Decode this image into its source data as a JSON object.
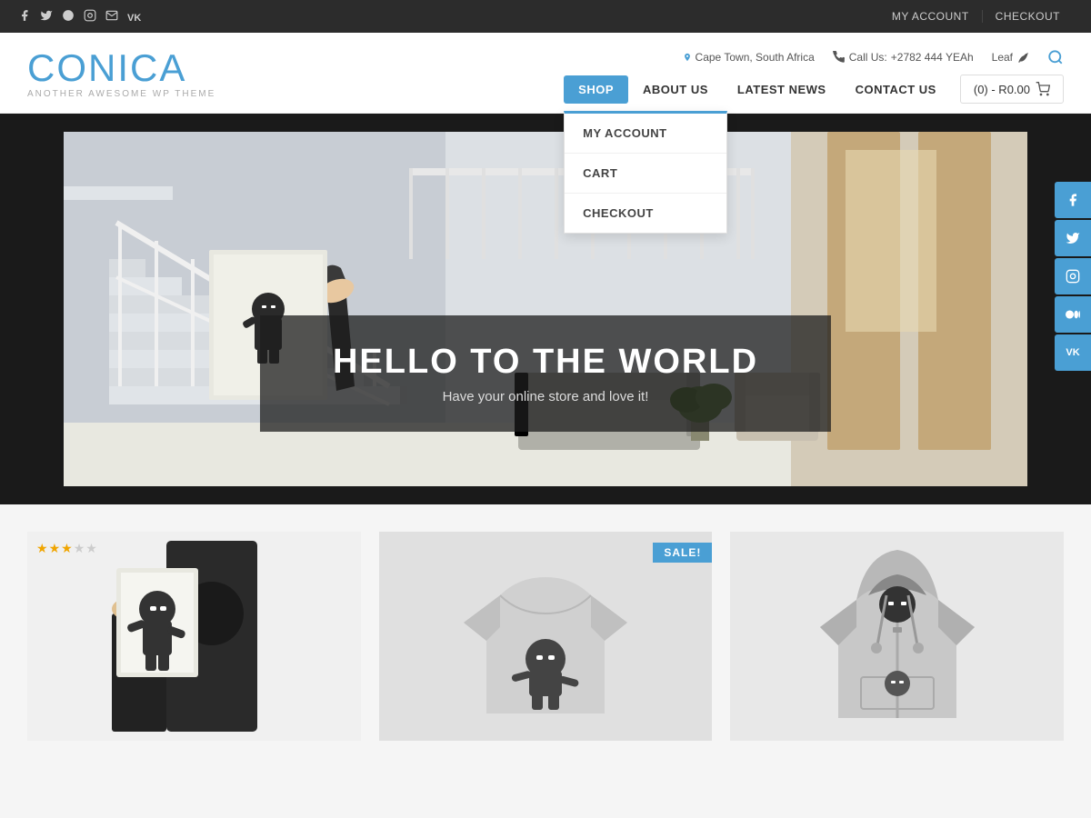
{
  "topBar": {
    "social": [
      {
        "name": "facebook",
        "icon": "f"
      },
      {
        "name": "twitter",
        "icon": "t"
      },
      {
        "name": "google",
        "icon": "g"
      },
      {
        "name": "instagram",
        "icon": "i"
      },
      {
        "name": "mail",
        "icon": "m"
      },
      {
        "name": "vk",
        "icon": "v"
      }
    ],
    "links": [
      {
        "label": "MY ACCOUNT",
        "url": "#"
      },
      {
        "label": "CHECKOUT",
        "url": "#"
      }
    ]
  },
  "header": {
    "logo": "CONICA",
    "tagline": "ANOTHER AWESOME WP THEME",
    "location": "Cape Town, South Africa",
    "phone_label": "Call Us:",
    "phone": "+2782 444 YEAh",
    "leaf": "Leaf"
  },
  "nav": {
    "items": [
      {
        "label": "SHOP",
        "active": true,
        "hasDropdown": true
      },
      {
        "label": "ABOUT US",
        "active": false
      },
      {
        "label": "LATEST NEWS",
        "active": false
      },
      {
        "label": "CONTACT US",
        "active": false
      }
    ],
    "cart": "(0) - R0.00",
    "dropdown": [
      {
        "label": "MY ACCOUNT"
      },
      {
        "label": "CART"
      },
      {
        "label": "CHECKOUT"
      }
    ]
  },
  "hero": {
    "title": "HELLO TO THE WORLD",
    "subtitle": "Have your online store and love it!"
  },
  "social_sidebar": [
    {
      "name": "facebook",
      "icon": "f"
    },
    {
      "name": "twitter",
      "icon": "t"
    },
    {
      "name": "instagram",
      "icon": "i"
    },
    {
      "name": "medium",
      "icon": "m"
    },
    {
      "name": "vk",
      "icon": "v"
    }
  ],
  "products": {
    "items": [
      {
        "id": 1,
        "hasStars": true,
        "rating": 3,
        "totalStars": 5,
        "hasSale": false,
        "type": "poster"
      },
      {
        "id": 2,
        "hasStars": false,
        "hasSale": true,
        "sale_label": "SALE!",
        "type": "tshirt"
      },
      {
        "id": 3,
        "hasStars": false,
        "hasSale": false,
        "type": "hoodie"
      }
    ]
  }
}
